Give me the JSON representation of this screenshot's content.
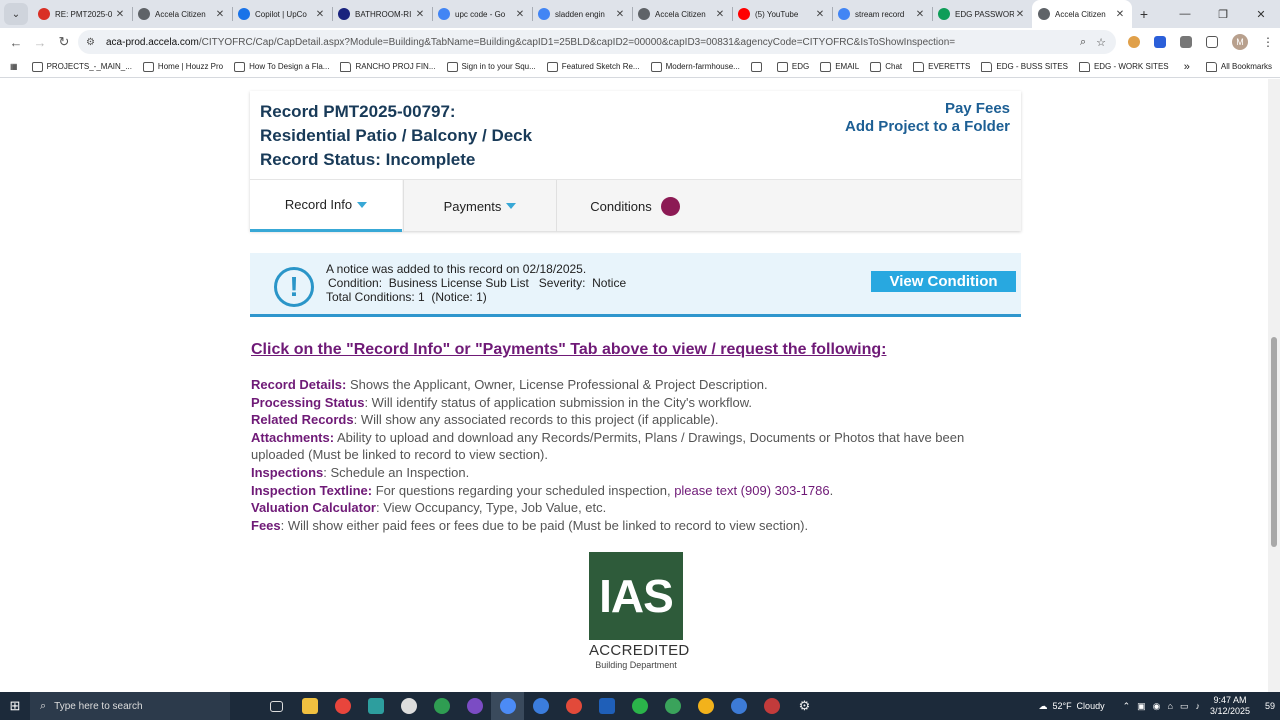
{
  "browser": {
    "tabs": [
      {
        "title": "RE: PMT2025-0",
        "color": "#d93025"
      },
      {
        "title": "Accela Citizen",
        "color": "#5f6368"
      },
      {
        "title": "Copilot | UpCo",
        "color": "#1a73e8"
      },
      {
        "title": "BATHROOM-RI",
        "color": "#1a237e"
      },
      {
        "title": "upc code - Go",
        "color": "#4285f4"
      },
      {
        "title": "sladden engin",
        "color": "#4285f4"
      },
      {
        "title": "Accela Citizen",
        "color": "#5f6368"
      },
      {
        "title": "(5) YouTube",
        "color": "#ff0000"
      },
      {
        "title": "stream record",
        "color": "#4285f4"
      },
      {
        "title": "EDG PASSWOR",
        "color": "#0f9d58"
      },
      {
        "title": "Accela Citizen",
        "color": "#5f6368"
      }
    ],
    "active_tab_index": 10,
    "new_tab": "+",
    "url_domain": "aca-prod.accela.com",
    "url_path": "/CITYOFRC/Cap/CapDetail.aspx?Module=Building&TabName=Building&capID1=25BLD&capID2=00000&capID3=00831&agencyCode=CITYOFRC&IsToShowInspection=",
    "profile_initial": "M",
    "bookmarks": [
      "PROJECTS_-_MAIN_...",
      "Home | Houzz Pro",
      "How To Design a Fla...",
      "RANCHO PROJ FIN...",
      "Sign in to your Squ...",
      "Featured Sketch Re...",
      "Modern-farmhouse...",
      "",
      "EDG",
      "EMAIL",
      "Chat",
      "EVERETTS",
      "EDG - BUSS SITES",
      "EDG - WORK SITES"
    ],
    "bookmarks_more": "»",
    "all_bookmarks": "All Bookmarks"
  },
  "record": {
    "title_line1": "Record PMT2025-00797:",
    "title_line2": "Residential Patio / Balcony / Deck",
    "status_line": "Record Status: Incomplete",
    "pay_fees": "Pay Fees",
    "add_to_folder": "Add Project to a Folder"
  },
  "record_tabs": [
    {
      "label": "Record Info"
    },
    {
      "label": "Payments"
    },
    {
      "label": "Conditions"
    }
  ],
  "notice": {
    "icon": "!",
    "line1": "A notice was added to this record on 02/18/2025.",
    "line2": "Condition:  Business License Sub List   Severity:  Notice",
    "line3": "Total Conditions: 1  (Notice: 1)",
    "button": "View Condition"
  },
  "info": {
    "heading": "Click on the \"Record Info\" or \"Payments\" Tab above to view / request the following:",
    "items": [
      {
        "label": "Record Details:",
        "text": " Shows the Applicant, Owner, License Professional & Project Description."
      },
      {
        "label": "Processing Status",
        "text": ": Will identify status of application submission in the City's workflow."
      },
      {
        "label": "Related Records",
        "text": ": Will show any associated records to this project (if applicable)."
      },
      {
        "label": "Attachments:",
        "text": " Ability to upload and download any Records/Permits, Plans / Drawings, Documents or Photos that have been uploaded (Must be linked to record to view section)."
      },
      {
        "label": "Inspections",
        "text": ": Schedule an Inspection."
      },
      {
        "label": "Inspection Textline:",
        "text": " For questions regarding your scheduled inspection, ",
        "extra": "please text (909) 303-1786",
        "tail": "."
      },
      {
        "label": "Valuation Calculator",
        "text": ": View Occupancy, Type, Job Value, etc."
      },
      {
        "label": "Fees",
        "text": ": Will show either paid fees or fees due to be paid (Must be linked to record to view section)."
      }
    ]
  },
  "logo": {
    "mark": "IAS",
    "accredited": "ACCREDITED",
    "department": "Building Department"
  },
  "taskbar": {
    "search_placeholder": "Type here to search",
    "weather": "52°F  Cloudy",
    "time": "9:47 AM",
    "date": "3/12/2025",
    "notification_count": "59"
  }
}
